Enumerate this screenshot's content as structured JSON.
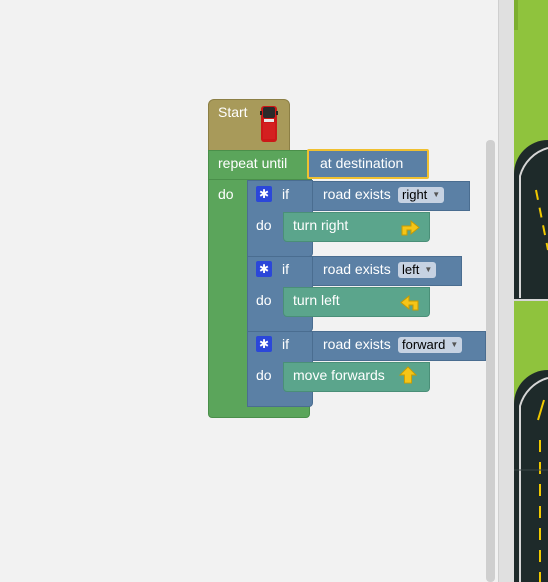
{
  "start": {
    "label": "Start",
    "icon": "van-icon"
  },
  "repeat": {
    "label": "repeat until",
    "do_label": "do",
    "condition": "at destination"
  },
  "blocks": [
    {
      "if_label": "if",
      "condition_label": "road exists",
      "direction": "right",
      "do_label": "do",
      "action": "turn right",
      "icon": "turn-right-arrow-icon"
    },
    {
      "if_label": "if",
      "condition_label": "road exists",
      "direction": "left",
      "do_label": "do",
      "action": "turn left",
      "icon": "turn-left-arrow-icon"
    },
    {
      "if_label": "if",
      "condition_label": "road exists",
      "direction": "forward",
      "do_label": "do",
      "action": "move forwards",
      "icon": "up-arrow-icon"
    }
  ],
  "colors": {
    "start_block": "#a89a5a",
    "repeat_block": "#5ba55b",
    "if_block": "#5b80a5",
    "action_block": "#5ba58c",
    "highlight": "#f0c030",
    "arrow": "#f5c518",
    "map_grass": "#8fc33d",
    "road": "#1e2a2a"
  }
}
